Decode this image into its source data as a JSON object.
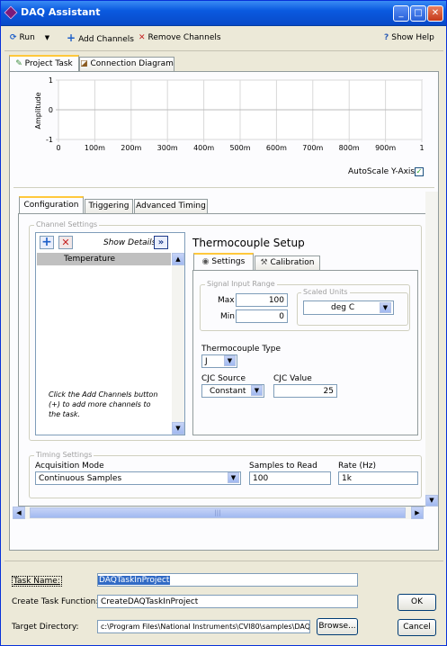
{
  "window": {
    "title": "DAQ Assistant"
  },
  "toolbar": {
    "run": "Run",
    "add_channels": "Add Channels",
    "remove_channels": "Remove Channels",
    "show_help": "Show Help"
  },
  "main_tabs": [
    "Project Task",
    "Connection Diagram"
  ],
  "graph": {
    "ylabel": "Amplitude",
    "y_ticks": [
      "1",
      "0",
      "-1"
    ],
    "x_ticks": [
      "0",
      "100m",
      "200m",
      "300m",
      "400m",
      "500m",
      "600m",
      "700m",
      "800m",
      "900m",
      "1"
    ],
    "autoscale_label": "AutoScale Y-Axis",
    "autoscale_checked": true
  },
  "config_tabs": [
    "Configuration",
    "Triggering",
    "Advanced Timing"
  ],
  "channel_settings": {
    "group_label": "Channel Settings",
    "show_details": "Show Details",
    "channels": [
      "Temperature"
    ],
    "hint": "Click the Add Channels button (+) to add more channels to the task."
  },
  "thermocouple": {
    "title": "Thermocouple Setup",
    "tabs": [
      "Settings",
      "Calibration"
    ],
    "signal_input_range_label": "Signal Input Range",
    "max_label": "Max",
    "max_value": "100",
    "min_label": "Min",
    "min_value": "0",
    "scaled_units_label": "Scaled Units",
    "scaled_units_value": "deg C",
    "tc_type_label": "Thermocouple Type",
    "tc_type_value": "J",
    "cjc_source_label": "CJC Source",
    "cjc_source_value": "Constant",
    "cjc_value_label": "CJC Value",
    "cjc_value": "25"
  },
  "timing": {
    "group_label": "Timing Settings",
    "mode_label": "Acquisition Mode",
    "mode_value": "Continuous Samples",
    "samples_label": "Samples to Read",
    "samples_value": "100",
    "rate_label": "Rate (Hz)",
    "rate_value": "1k"
  },
  "bottom": {
    "task_name_label": "Task Name:",
    "task_name_value": "DAQTaskInProject",
    "create_fn_label": "Create Task Function:",
    "create_fn_value": "CreateDAQTaskInProject",
    "target_dir_label": "Target Directory:",
    "target_dir_value": "c:\\Program Files\\National Instruments\\CVI80\\samples\\DAQ",
    "browse": "Browse...",
    "ok": "OK",
    "cancel": "Cancel"
  }
}
